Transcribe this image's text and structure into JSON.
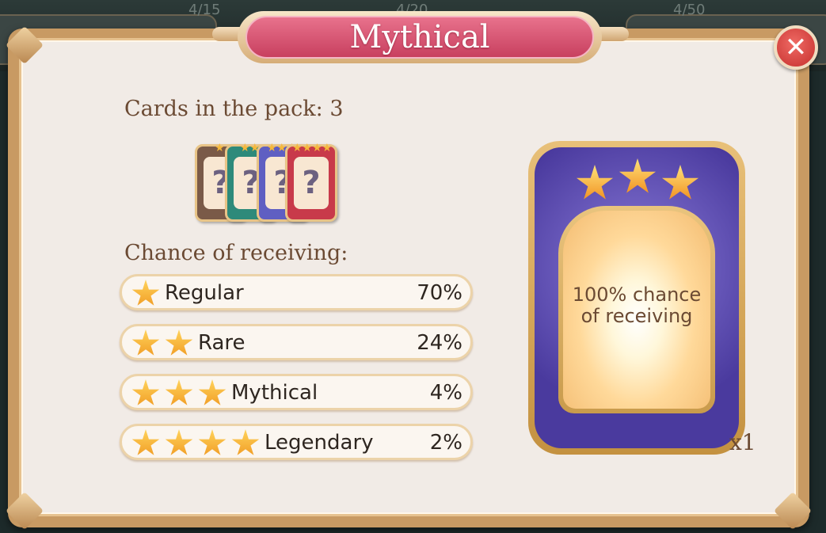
{
  "background": {
    "tabs": [
      "4/15",
      "4/20",
      "4/50"
    ]
  },
  "dialog": {
    "title": "Mythical",
    "close_icon": "close-icon",
    "cards_label": "Cards in the pack: 3",
    "chance_label": "Chance of receiving:",
    "rarities": [
      {
        "name": "Regular",
        "stars": 1,
        "percent": "70%"
      },
      {
        "name": "Rare",
        "stars": 2,
        "percent": "24%"
      },
      {
        "name": "Mythical",
        "stars": 3,
        "percent": "4%"
      },
      {
        "name": "Legendary",
        "stars": 4,
        "percent": "2%"
      }
    ],
    "guaranteed_card": {
      "stars": 3,
      "text": "100% chance of receiving",
      "line1": "100% chance",
      "line2": "of receiving",
      "quantity": "x1"
    },
    "colors": {
      "title_pill": "#d4506e",
      "panel_bg": "#f1ebe6",
      "gold": "#c89a63",
      "close_red": "#d8403c",
      "card_purple": "#5a48b0"
    }
  }
}
